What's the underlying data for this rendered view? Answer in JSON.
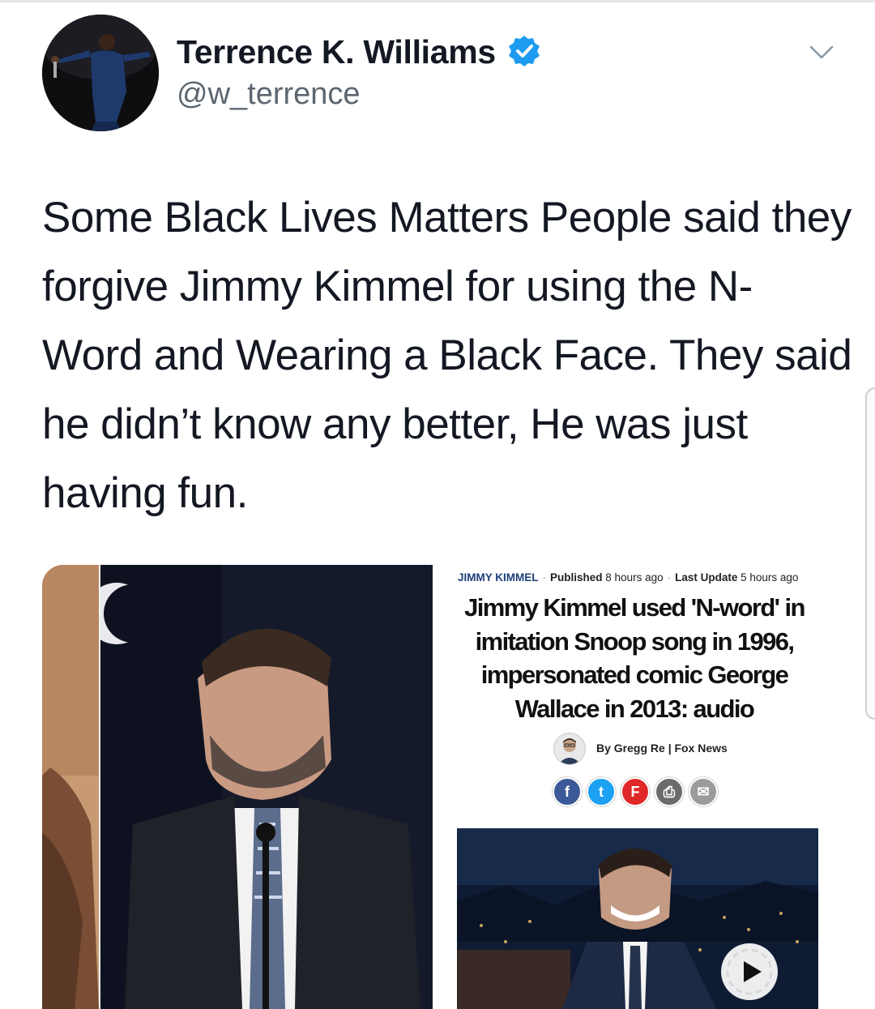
{
  "tweet": {
    "display_name": "Terrence K. Williams",
    "handle": "@w_terrence",
    "verified": true,
    "text": "Some Black Lives Matters People said they forgive Jimmy Kimmel for using the N- Word and Wearing a Black Face. They said he didn’t know any better, He was just having fun."
  },
  "article": {
    "topic": "JIMMY KIMMEL",
    "published_label": "Published",
    "published_value": "8 hours ago",
    "updated_label": "Last Update",
    "updated_value": "5 hours ago",
    "headline": "Jimmy Kimmel used 'N-word' in imitation Snoop song in 1996, impersonated comic George Wallace in 2013: audio",
    "byline": "By Gregg Re | Fox News",
    "share_buttons": [
      {
        "icon": "facebook-icon",
        "glyph": "f",
        "color": "#3b5998"
      },
      {
        "icon": "twitter-icon",
        "glyph": "t",
        "color": "#1da1f2"
      },
      {
        "icon": "flipboard-icon",
        "glyph": "F",
        "color": "#e12828"
      },
      {
        "icon": "print-icon",
        "glyph": "⎙",
        "color": "#6b6b6b"
      },
      {
        "icon": "email-icon",
        "glyph": "✉",
        "color": "#9b9b9b"
      }
    ]
  },
  "colors": {
    "verified_blue": "#1d9bf0",
    "text": "#141823",
    "secondary_text": "#5b6670",
    "link_blue": "#1d3f7a"
  }
}
